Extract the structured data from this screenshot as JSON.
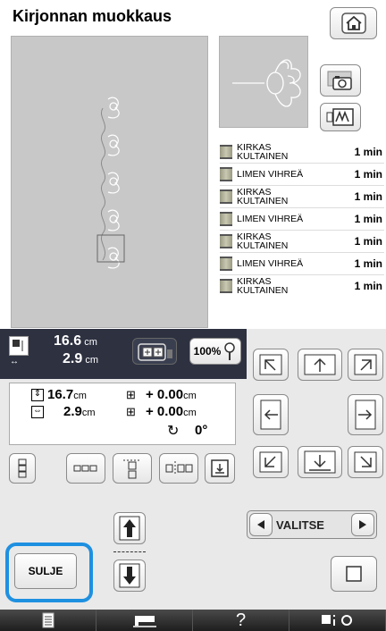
{
  "title": "Kirjonnan muokkaus",
  "threads": [
    {
      "name_line1": "KIRKAS",
      "name_line2": "KULTAINEN",
      "time": "1 min"
    },
    {
      "name_line1": "LIMEN VIHREÄ",
      "name_line2": "",
      "time": "1 min"
    },
    {
      "name_line1": "KIRKAS",
      "name_line2": "KULTAINEN",
      "time": "1 min"
    },
    {
      "name_line1": "LIMEN VIHREÄ",
      "name_line2": "",
      "time": "1 min"
    },
    {
      "name_line1": "KIRKAS",
      "name_line2": "KULTAINEN",
      "time": "1 min"
    },
    {
      "name_line1": "LIMEN VIHREÄ",
      "name_line2": "",
      "time": "1 min"
    },
    {
      "name_line1": "KIRKAS",
      "name_line2": "KULTAINEN",
      "time": "1 min"
    }
  ],
  "size_display": {
    "width": "16.6",
    "height": "2.9",
    "unit": "cm"
  },
  "zoom": "100%",
  "info": {
    "height_value": "16.7",
    "width_value": "2.9",
    "unit": "cm",
    "offset_y": "+ 0.00",
    "offset_x": "+ 0.00",
    "rotation": "0°"
  },
  "valitse_label": "VALITSE",
  "sulje_label": "SULJE",
  "bottom_bar": {
    "help_label": "?"
  }
}
